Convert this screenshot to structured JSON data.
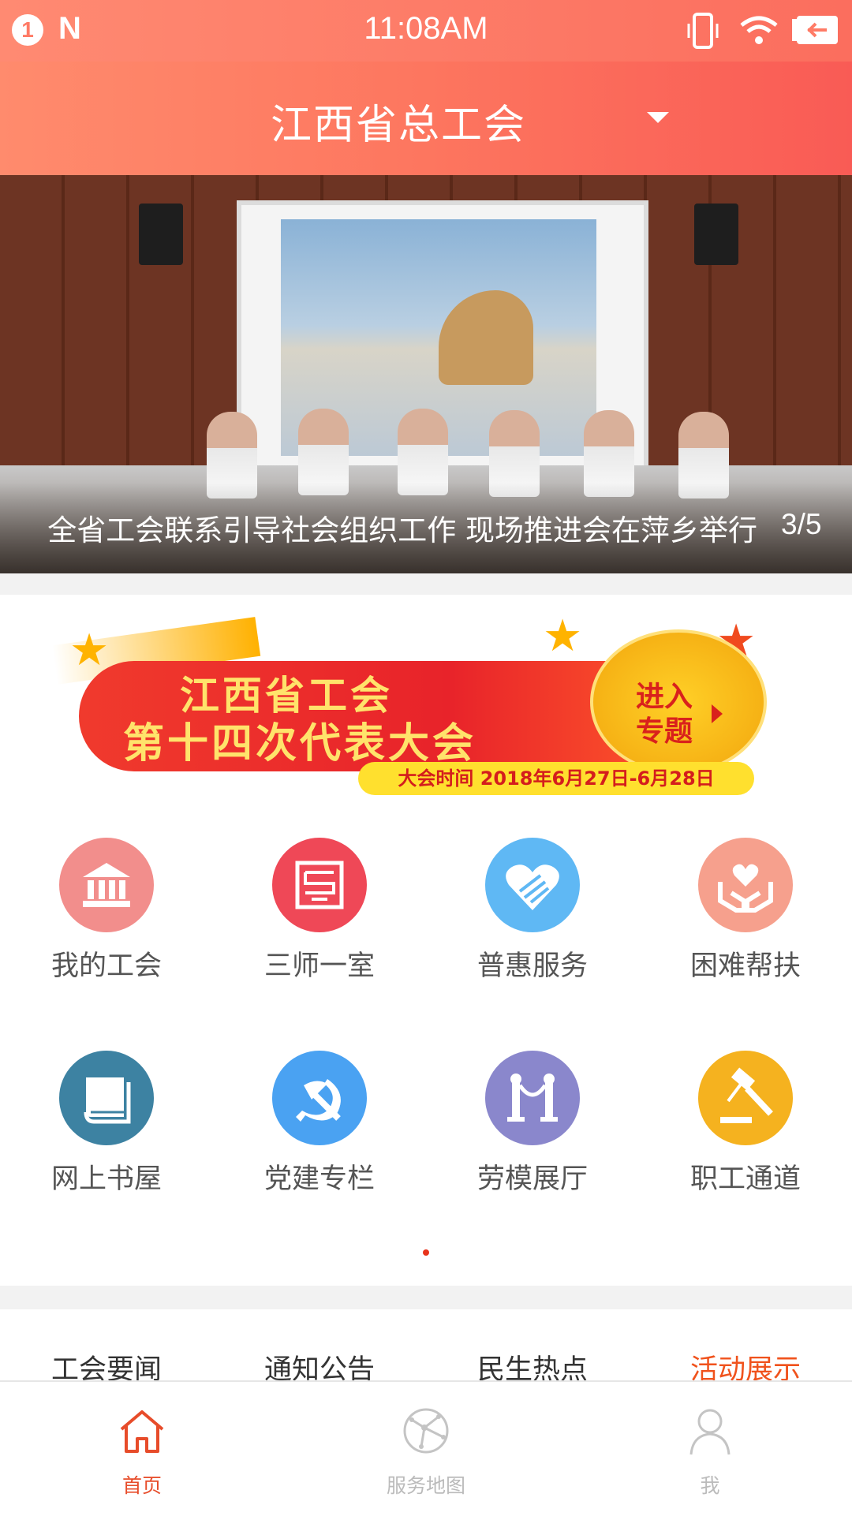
{
  "status_bar": {
    "time": "11:08AM",
    "notification_count": "1",
    "n_label": "N"
  },
  "header": {
    "title": "江西省总工会"
  },
  "banner": {
    "caption": "全省工会联系引导社会组织工作 现场推进会在萍乡举行",
    "pager": "3/5"
  },
  "promo": {
    "line1": "江西省工会",
    "line2": "第十四次代表大会",
    "enter_line1": "进入",
    "enter_line2": "专题",
    "date": "大会时间  2018年6月27日-6月28日"
  },
  "grid": {
    "items": [
      {
        "label": "我的工会",
        "icon": "bank-icon",
        "color": "#f28e8c"
      },
      {
        "label": "三师一室",
        "icon": "seal-icon",
        "color": "#ef4857"
      },
      {
        "label": "普惠服务",
        "icon": "heart-hand-icon",
        "color": "#5fb8f4"
      },
      {
        "label": "困难帮扶",
        "icon": "caring-hands-icon",
        "color": "#f6a08d"
      },
      {
        "label": "网上书屋",
        "icon": "book-icon",
        "color": "#3d82a2"
      },
      {
        "label": "党建专栏",
        "icon": "hammer-sickle-icon",
        "color": "#4aa2f2"
      },
      {
        "label": "劳模展厅",
        "icon": "exhibit-icon",
        "color": "#8a87cc"
      },
      {
        "label": "职工通道",
        "icon": "gavel-icon",
        "color": "#f5b21f"
      }
    ]
  },
  "tabs": {
    "items": [
      {
        "label": "工会要闻"
      },
      {
        "label": "通知公告"
      },
      {
        "label": "民生热点"
      },
      {
        "label": "活动展示"
      }
    ],
    "active_index": 3,
    "active_color": "#f0521c"
  },
  "bottom_nav": {
    "items": [
      {
        "label": "首页",
        "icon": "home-icon"
      },
      {
        "label": "服务地图",
        "icon": "globe-icon"
      },
      {
        "label": "我",
        "icon": "person-icon"
      }
    ],
    "active_index": 0,
    "active_color": "#e74c2a"
  }
}
